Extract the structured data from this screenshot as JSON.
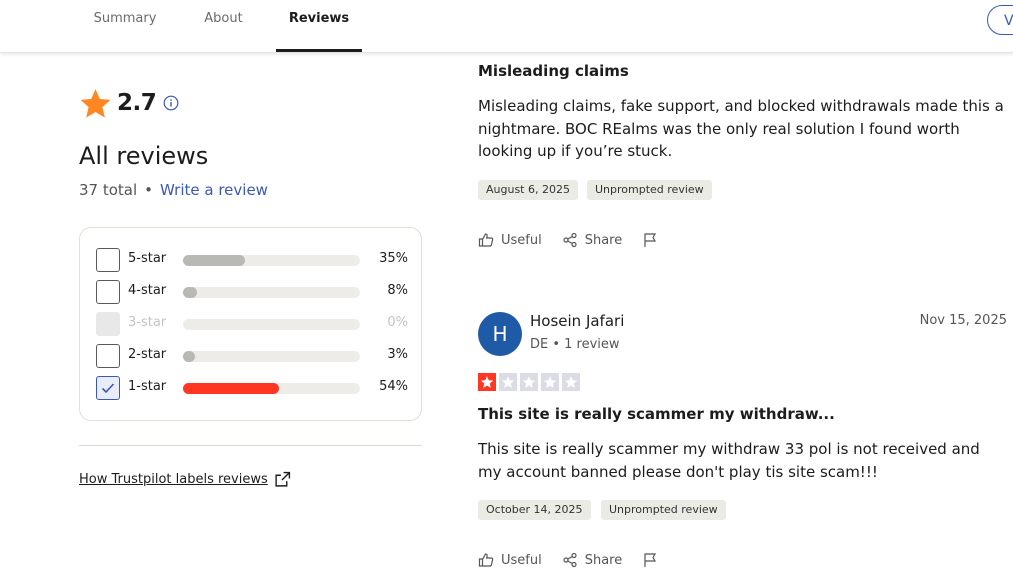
{
  "nav": {
    "tabs": [
      {
        "label": "Summary",
        "active": false
      },
      {
        "label": "About",
        "active": false
      },
      {
        "label": "Reviews",
        "active": true
      }
    ],
    "visit_label": "V"
  },
  "overview": {
    "rating": "2.7",
    "heading": "All reviews",
    "total": "37 total",
    "separator": "•",
    "write_review": "Write a review",
    "star_color": "#ff8622",
    "link_color": "#3c57bc"
  },
  "filters": [
    {
      "label": "5-star",
      "percent": "35%",
      "fill": 0.35,
      "checked": false,
      "disabled": false,
      "color": "#b9b9b4"
    },
    {
      "label": "4-star",
      "percent": "8%",
      "fill": 0.08,
      "checked": false,
      "disabled": false,
      "color": "#b9b9b4"
    },
    {
      "label": "3-star",
      "percent": "0%",
      "fill": 0.0,
      "checked": false,
      "disabled": true,
      "color": "#b9b9b4"
    },
    {
      "label": "2-star",
      "percent": "3%",
      "fill": 0.03,
      "checked": false,
      "disabled": false,
      "color": "#b9b9b4"
    },
    {
      "label": "1-star",
      "percent": "54%",
      "fill": 0.54,
      "checked": true,
      "disabled": false,
      "color": "#ff3722"
    }
  ],
  "labels_link": "How Trustpilot labels reviews",
  "reviews": [
    {
      "title": "Misleading claims",
      "body": "Misleading claims, fake support, and blocked withdrawals made this a nightmare. BOC REalms was the only real solution I found worth looking up if you’re stuck.",
      "experience_date": "August 6, 2025",
      "label": "Unprompted review",
      "useful": "Useful",
      "share": "Share"
    },
    {
      "author_initial": "H",
      "author": "Hosein Jafari",
      "meta": "DE • 1 review",
      "date": "Nov 15, 2025",
      "stars": 1,
      "star_color": "#ff3722",
      "title": "This site is really scammer my withdraw...",
      "body": "This site is really scammer my withdraw 33 pol is not received and my account banned please don't play tis site scam!!!",
      "experience_date": "October 14, 2025",
      "label": "Unprompted review",
      "useful": "Useful",
      "share": "Share"
    }
  ]
}
